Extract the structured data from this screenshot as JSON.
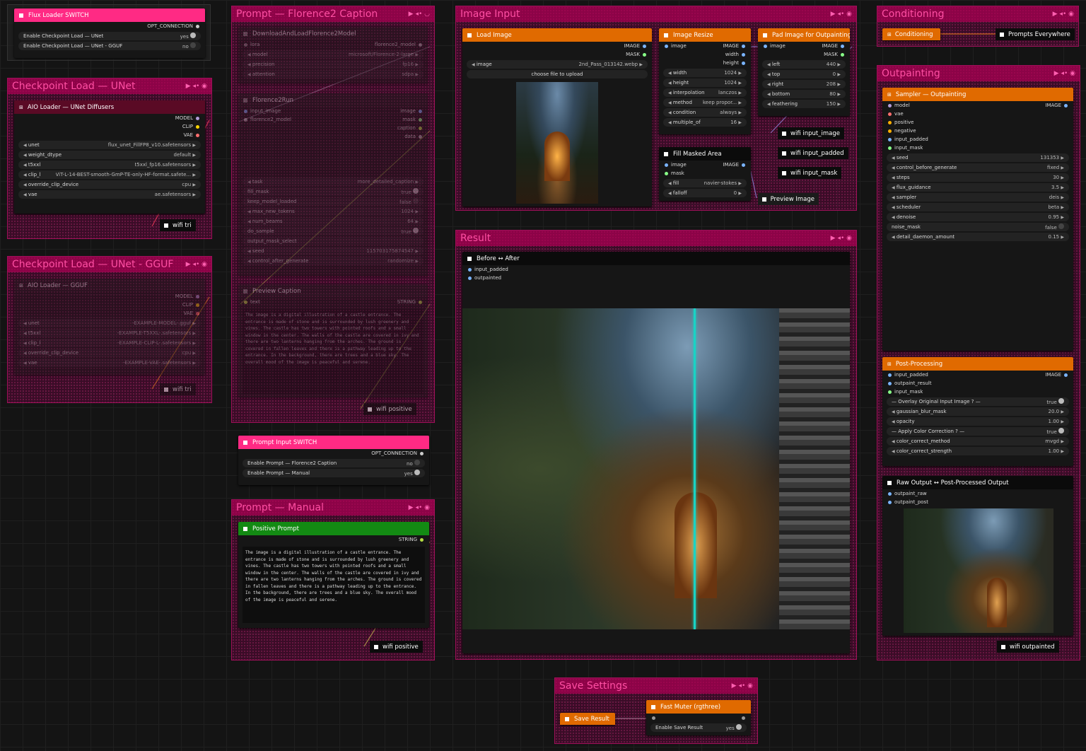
{
  "groups": {
    "flux_switch": "",
    "ckpt_unet": "Checkpoint Load — UNet",
    "ckpt_gguf": "Checkpoint Load — UNet - GGUF",
    "prompt_florence": "Prompt — Florence2 Caption",
    "prompt_manual": "Prompt — Manual",
    "image_input": "Image Input",
    "result": "Result",
    "conditioning": "Conditioning",
    "outpainting": "Outpainting",
    "save_settings": "Save Settings"
  },
  "flux_loader_switch": {
    "title": "Flux Loader SWITCH",
    "output": "OPT_CONNECTION",
    "rows": [
      {
        "label": "Enable Checkpoint Load — UNet",
        "value": "yes"
      },
      {
        "label": "Enable Checkpoint Load — UNet - GGUF",
        "value": "no"
      }
    ]
  },
  "aio_loader": {
    "title": "AIO Loader — UNet Diffusers",
    "outputs": [
      "MODEL",
      "CLIP",
      "VAE"
    ],
    "widgets": [
      {
        "label": "unet",
        "value": "flux_unet_FillFP8_v10.safetensors"
      },
      {
        "label": "weight_dtype",
        "value": "default"
      },
      {
        "label": "t5xxl",
        "value": "t5xxl_fp16.safetensors"
      },
      {
        "label": "clip_l",
        "value": "ViT-L-14-BEST-smooth-GmP-TE-only-HF-format.safete..."
      },
      {
        "label": "override_clip_device",
        "value": "cpu"
      },
      {
        "label": "vae",
        "value": "ae.safetensors"
      }
    ],
    "wifi": "wifi tri"
  },
  "aio_gguf": {
    "title": "AIO Loader — GGUF",
    "outputs": [
      "MODEL",
      "CLIP",
      "VAE"
    ],
    "widgets": [
      {
        "label": "unet",
        "value": "-EXAMPLE-MODEL-.gguf"
      },
      {
        "label": "t5xxl",
        "value": "-EXAMPLE-T5XXL-.safetensors"
      },
      {
        "label": "clip_l",
        "value": "-EXAMPLE-CLIP-L-.safetensors"
      },
      {
        "label": "override_clip_device",
        "value": "cpu"
      },
      {
        "label": "vae",
        "value": "-EXAMPLE-VAE-.safetensors"
      }
    ],
    "wifi": "wifi tri"
  },
  "florence_load": {
    "title": "DownloadAndLoadFlorence2Model",
    "input": "lora",
    "output": "florence2_model",
    "widgets": [
      {
        "label": "model",
        "value": "microsoft/Florence-2-large"
      },
      {
        "label": "precision",
        "value": "fp16"
      },
      {
        "label": "attention",
        "value": "sdpa"
      }
    ]
  },
  "florence_run": {
    "title": "Florence2Run",
    "inputs": [
      "input_image",
      "florence2_model"
    ],
    "outputs": [
      "image",
      "mask",
      "caption",
      "data"
    ],
    "widgets": [
      {
        "label": "task",
        "value": "more_detailed_caption"
      },
      {
        "label": "fill_mask",
        "value": "true"
      },
      {
        "label": "keep_model_loaded",
        "value": "false"
      },
      {
        "label": "max_new_tokens",
        "value": "1024"
      },
      {
        "label": "num_beams",
        "value": "64"
      },
      {
        "label": "do_sample",
        "value": "true"
      },
      {
        "label": "output_mask_select",
        "value": ""
      },
      {
        "label": "seed",
        "value": "115703175874547"
      },
      {
        "label": "control_after_generate",
        "value": "randomize"
      }
    ]
  },
  "preview_caption": {
    "title": "Preview Caption",
    "input": "text",
    "output": "STRING",
    "text": "The image is a digital illustration of a castle entrance. The entrance is made of stone and is surrounded by lush greenery and vines. The castle has two towers with pointed roofs and a small window in the center. The walls of the castle are covered in ivy and there are two lanterns hanging from the arches. The ground is covered in fallen leaves and there is a pathway leading up to the entrance. In the background, there are trees and a blue sky. The overall mood of the image is peaceful and serene.",
    "wifi": "wifi positive"
  },
  "prompt_switch": {
    "title": "Prompt Input SWITCH",
    "output": "OPT_CONNECTION",
    "rows": [
      {
        "label": "Enable Prompt — Florence2 Caption",
        "value": "no"
      },
      {
        "label": "Enable Prompt — Manual",
        "value": "yes"
      }
    ]
  },
  "positive_prompt": {
    "title": "Positive Prompt",
    "output": "STRING",
    "text": "The image is a digital illustration of a castle entrance. The entrance is made of stone and is surrounded by lush greenery and vines. The castle has two towers with pointed roofs and a small window in the center. The walls of the castle are covered in ivy and there are two lanterns hanging from the arches. The ground is covered in fallen leaves and there is a pathway leading up to the entrance. In the background, there are trees and a blue sky. The overall mood of the image is peaceful and serene.",
    "wifi": "wifi positive"
  },
  "load_image": {
    "title": "Load Image",
    "outputs": [
      "IMAGE",
      "MASK"
    ],
    "image_label": "image",
    "image_value": "2nd_Pass_013142.webp",
    "upload": "choose file to upload"
  },
  "image_resize": {
    "title": "Image Resize",
    "input": "image",
    "outputs": [
      "IMAGE",
      "width",
      "height"
    ],
    "widgets": [
      {
        "label": "width",
        "value": "1024"
      },
      {
        "label": "height",
        "value": "1024"
      },
      {
        "label": "interpolation",
        "value": "lanczos"
      },
      {
        "label": "method",
        "value": "keep propor..."
      },
      {
        "label": "condition",
        "value": "always"
      },
      {
        "label": "multiple_of",
        "value": "16"
      }
    ]
  },
  "pad_image": {
    "title": "Pad Image for Outpainting",
    "input": "image",
    "outputs": [
      "IMAGE",
      "MASK"
    ],
    "widgets": [
      {
        "label": "left",
        "value": "440"
      },
      {
        "label": "top",
        "value": "0"
      },
      {
        "label": "right",
        "value": "208"
      },
      {
        "label": "bottom",
        "value": "80"
      },
      {
        "label": "feathering",
        "value": "150"
      }
    ]
  },
  "fill_masked": {
    "title": "Fill Masked Area",
    "inputs": [
      "image",
      "mask"
    ],
    "output": "IMAGE",
    "widgets": [
      {
        "label": "fill",
        "value": "navier-stokes"
      },
      {
        "label": "falloff",
        "value": "0"
      }
    ]
  },
  "wifi_labels": {
    "input_image": "wifi input_image",
    "input_padded": "wifi input_padded",
    "input_mask": "wifi input_mask",
    "preview_image": "Preview Image",
    "outpainted": "wifi outpainted"
  },
  "before_after": {
    "title": "Before ↔ After",
    "inputs": [
      "input_padded",
      "outpainted"
    ]
  },
  "conditioning": {
    "title": "Conditioning",
    "target": "Prompts Everywhere"
  },
  "sampler": {
    "title": "Sampler — Outpainting",
    "inputs": [
      "model",
      "vae",
      "positive",
      "negative",
      "input_padded",
      "input_mask"
    ],
    "output": "IMAGE",
    "widgets": [
      {
        "label": "seed",
        "value": "131353"
      },
      {
        "label": "control_before_generate",
        "value": "fixed"
      },
      {
        "label": "steps",
        "value": "30"
      },
      {
        "label": "flux_guidance",
        "value": "3.5"
      },
      {
        "label": "sampler",
        "value": "deis"
      },
      {
        "label": "scheduler",
        "value": "beta"
      },
      {
        "label": "denoise",
        "value": "0.95"
      },
      {
        "label": "noise_mask",
        "value": "false"
      },
      {
        "label": "detail_daemon_amount",
        "value": "0.15"
      }
    ]
  },
  "post_processing": {
    "title": "Post-Processing",
    "inputs": [
      "input_padded",
      "outpaint_result",
      "input_mask"
    ],
    "output": "IMAGE",
    "widgets": [
      {
        "label": "— Overlay Original Input Image ? —",
        "value": "true"
      },
      {
        "label": "gaussian_blur_mask",
        "value": "20.0"
      },
      {
        "label": "opacity",
        "value": "1.00"
      },
      {
        "label": "— Apply Color Correction ? —",
        "value": "true"
      },
      {
        "label": "color_correct_method",
        "value": "mvgd"
      },
      {
        "label": "color_correct_strength",
        "value": "1.00"
      }
    ]
  },
  "raw_vs_post": {
    "title": "Raw Output ↔ Post-Processed Output",
    "inputs": [
      "outpaint_raw",
      "outpaint_post"
    ]
  },
  "save": {
    "save_result": "Save Result",
    "fast_muter": "Fast Muter (rgthree)",
    "enable_label": "Enable Save Result",
    "enable_value": "yes"
  },
  "colors": {
    "group_border": "#a0105a",
    "group_title": "#ff4fa3",
    "orange_header": "#e06a00",
    "pink_header": "#ff2a84",
    "green_header": "#138a13"
  }
}
